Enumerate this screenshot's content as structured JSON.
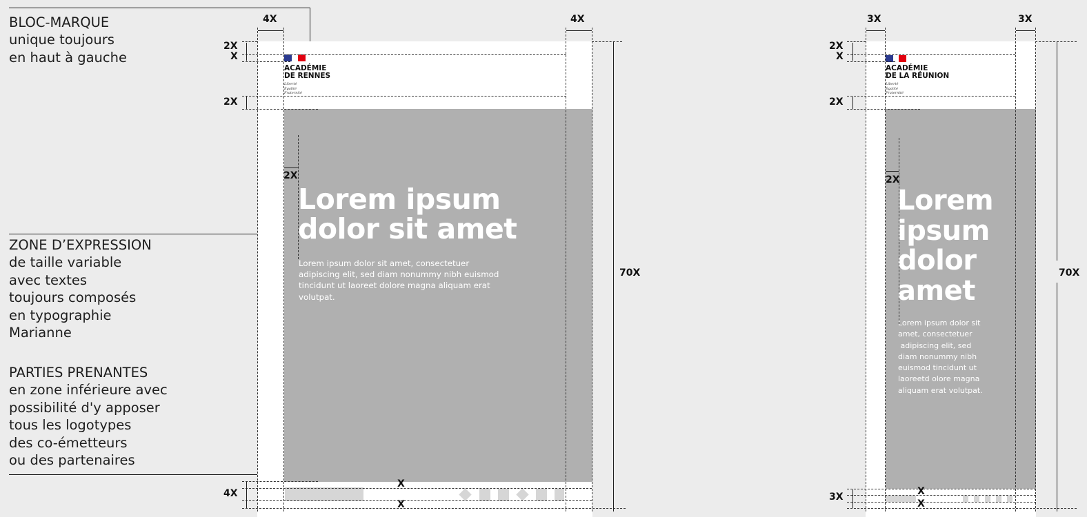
{
  "annotations": {
    "bloc_marque": [
      "BLOC-MARQUE",
      "unique toujours",
      "en haut à gauche"
    ],
    "zone_expression": [
      "ZONE D’EXPRESSION",
      "de taille variable",
      "avec textes",
      "toujours composés",
      "en typographie",
      "Marianne"
    ],
    "parties_prenantes": [
      "PARTIES PRENANTES",
      "en zone inférieure avec",
      "possibilité d'y apposer",
      "tous les logotypes",
      "des co-émetteurs",
      "ou des partenaires"
    ]
  },
  "poster_large": {
    "brand_lines": [
      "ACADÉMIE",
      "DE RENNES"
    ],
    "motto": [
      "Liberté",
      "Égalité",
      "Fraternité"
    ],
    "title_lines": [
      "Lorem ipsum",
      "dolor sit amet"
    ],
    "body_lines": [
      "Lorem ipsum dolor sit amet, consectetuer",
      "adipiscing elit, sed diam nonummy nibh euismod",
      "tincidunt ut laoreet dolore magna aliquam erat",
      "volutpat."
    ],
    "dims": {
      "margin_side": "4X",
      "top_margin": "2X",
      "logo_gap": "X",
      "below_brand": "2X",
      "inner_margin": "2X",
      "bottom_zone": "4X",
      "logo_zone_gap_top": "X",
      "logo_zone_gap_bottom": "X",
      "height": "70X"
    }
  },
  "poster_narrow": {
    "brand_lines": [
      "ACADÉMIE",
      "DE LA RÉUNION"
    ],
    "motto": [
      "Liberté",
      "Égalité",
      "Fraternité"
    ],
    "title_lines": [
      "Lorem",
      "ipsum",
      "dolor",
      "amet"
    ],
    "body_lines": [
      "Lorem ipsum dolor sit",
      "amet, consectetuer",
      " adipiscing elit, sed",
      "diam nonummy nibh",
      "euismod tincidunt ut",
      "laoreetd olore magna",
      "aliquam erat volutpat."
    ],
    "dims": {
      "margin_side": "3X",
      "top_margin": "2X",
      "logo_gap": "X",
      "below_brand": "2X",
      "inner_margin": "2X",
      "bottom_zone": "3X",
      "logo_zone_gap_top": "X",
      "logo_zone_gap_bottom": "X",
      "height": "70X"
    }
  },
  "colors": {
    "background": "#ececec",
    "poster": "#ffffff",
    "visual": "#b0b0b0",
    "flag_blue": "#2b3a8f",
    "flag_red": "#e1000f",
    "logo_placeholder": "#d6d6d6"
  }
}
